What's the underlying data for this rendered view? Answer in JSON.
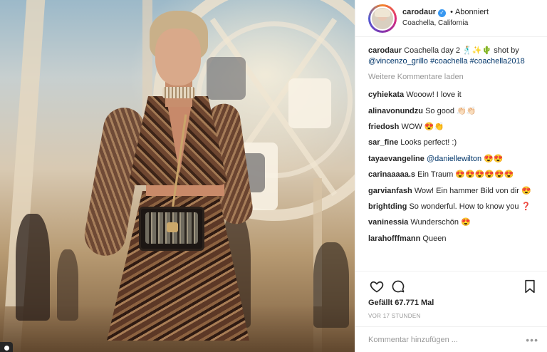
{
  "post": {
    "author": "carodaur",
    "follow_state": "Abonniert",
    "dot": "•",
    "location": "Coachella, California",
    "caption": {
      "user": "carodaur",
      "text": "Coachella day 2 🕺🏼✨🌵 shot by",
      "mention": "@vincenzo_grillo",
      "tag1": "#coachella",
      "tag2": "#coachella2018"
    },
    "load_more": "Weitere Kommentare laden",
    "comments": [
      {
        "user": "cyhiekata",
        "text": "Wooow! I love it"
      },
      {
        "user": "alinavonundzu",
        "text": "So good 👏🏻👏🏻"
      },
      {
        "user": "friedosh",
        "text": "WOW 😍👏"
      },
      {
        "user": "sar_fine",
        "text": "Looks perfect! :)"
      },
      {
        "user": "tayaevangeline",
        "text": "@daniellewilton 😍😍"
      },
      {
        "user": "carinaaaaa.s",
        "text": "Ein Traum 😍😍😍😍😍😍"
      },
      {
        "user": "garvianfash",
        "text": "Wow! Ein hammer Bild von dir 😍"
      },
      {
        "user": "brightding",
        "text": "So wonderful. How to know you ❓"
      },
      {
        "user": "vaninessia",
        "text": "Wunderschön 😍"
      },
      {
        "user": "larahofffmann",
        "text": "Queen"
      }
    ],
    "likes": "Gefällt 67.771 Mal",
    "time": "VOR 17 STUNDEN",
    "add_comment_placeholder": "Kommentar hinzufügen ...",
    "more": "•••"
  },
  "icons": {
    "verified": "verified-icon",
    "like": "heart-icon",
    "comment": "comment-icon",
    "save": "bookmark-icon"
  },
  "colors": {
    "link": "#003569",
    "verified": "#3897f0",
    "text": "#262626",
    "muted": "#999999"
  }
}
